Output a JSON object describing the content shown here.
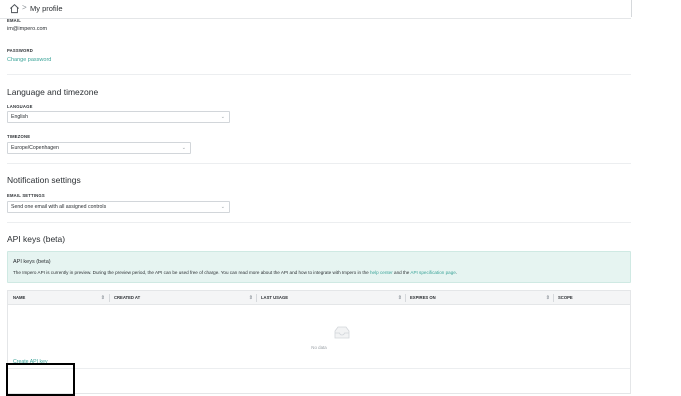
{
  "header": {
    "separator": ">",
    "title": "My profile"
  },
  "email": {
    "label": "EMAIL",
    "value": "im@impero.com"
  },
  "password": {
    "label": "PASSWORD",
    "link": "Change password"
  },
  "language_section": {
    "heading": "Language and timezone",
    "language": {
      "label": "LANGUAGE",
      "value": "English"
    },
    "timezone": {
      "label": "TIMEZONE",
      "value": "Europe/Copenhagen"
    }
  },
  "notification_section": {
    "heading": "Notification settings",
    "email_settings": {
      "label": "EMAIL SETTINGS",
      "value": "Send one email with all assigned controls"
    }
  },
  "api_section": {
    "heading": "API keys (beta)",
    "info": {
      "title": "API keys (beta)",
      "text_before": "The Impero API is currently in preview. During the preview period, the API can be used free of charge. You can read more about the API and how to integrate with Impero in the ",
      "help_link": "help center",
      "text_mid": " and the ",
      "spec_link": "API specification page",
      "text_end": "."
    },
    "table": {
      "columns": [
        "NAME",
        "CREATED AT",
        "LAST USAGE",
        "EXPIRES ON",
        "SCOPE"
      ],
      "empty_text": "No data"
    },
    "create_button": "Create API key"
  },
  "colors": {
    "accent": "#3aa398",
    "info_bg": "#e6f4f1",
    "header_bg": "#f4f5f6"
  },
  "icons": [
    "home-icon",
    "chevron-right-icon",
    "dropdown-caret-icon",
    "sort-icon",
    "empty-inbox-icon"
  ]
}
